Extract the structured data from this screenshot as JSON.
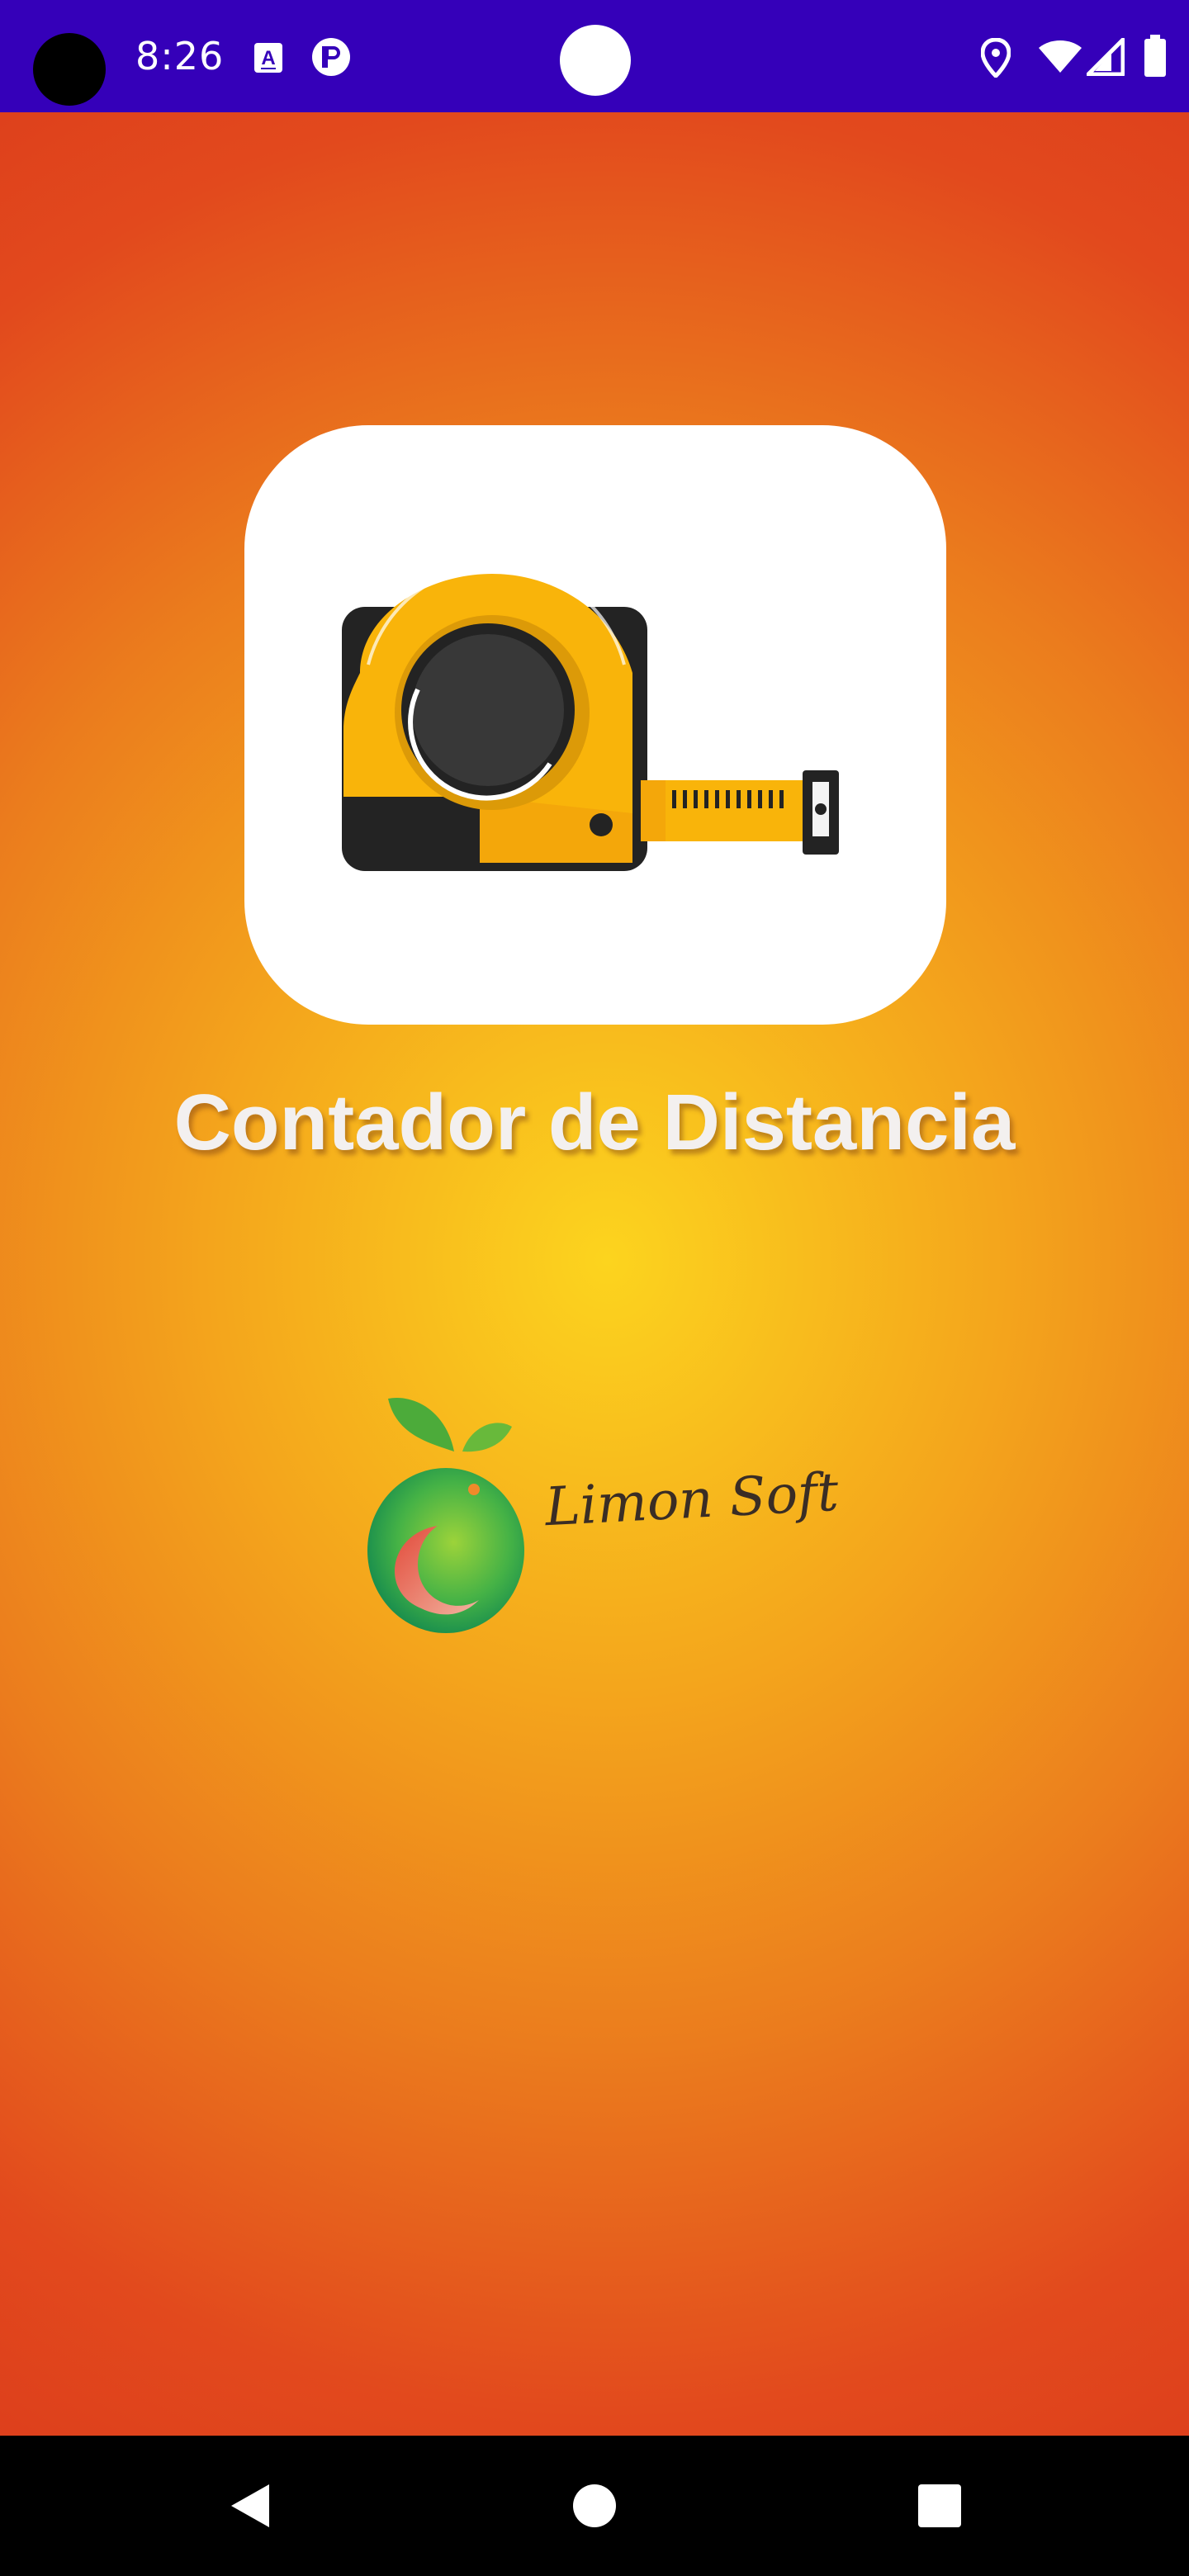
{
  "status_bar": {
    "time": "8:26",
    "background_color": "#3500b9",
    "left_icons": [
      "text-recognition-icon",
      "notification-app-icon"
    ],
    "right_icons": [
      "location-icon",
      "wifi-icon",
      "cell-signal-icon",
      "battery-icon"
    ]
  },
  "splash": {
    "app_icon": "tape-measure-icon",
    "app_name": "Contador de Distancia",
    "developer_logo_icon": "lemon-fruit-logo",
    "developer_name": "Limon Soft",
    "gradient_colors": [
      "#fcd41e",
      "#f4a51c",
      "#eb7c1d",
      "#e2491d"
    ]
  },
  "nav_bar": {
    "buttons": [
      "back-icon",
      "home-icon",
      "recents-icon"
    ],
    "icon_color": "#ffffff"
  }
}
